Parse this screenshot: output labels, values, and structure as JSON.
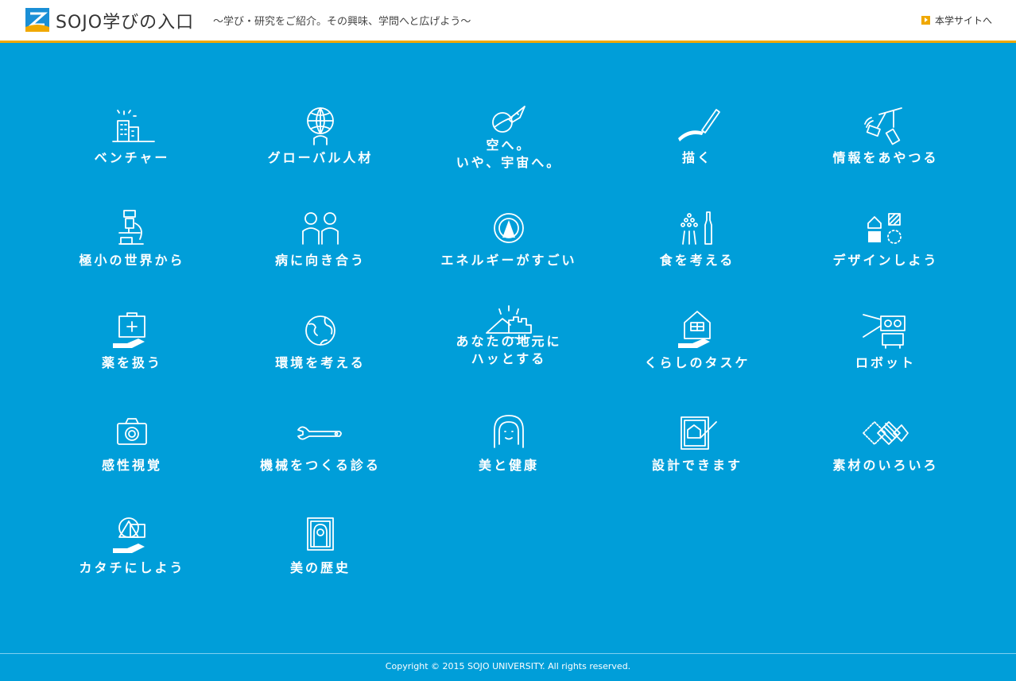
{
  "header": {
    "title": "SOJO学びの入口",
    "tagline": "〜学び・研究をご紹介。その興味、学問へと広げよう〜",
    "main_site_link": "本学サイトへ"
  },
  "tiles": [
    {
      "label": "ベンチャー",
      "icon": "buildings-icon"
    },
    {
      "label": "グローバル人材",
      "icon": "globe-person-icon"
    },
    {
      "label": "空へ。\nいや、宇宙へ。",
      "icon": "rocket-icon"
    },
    {
      "label": "描く",
      "icon": "pen-icon"
    },
    {
      "label": "情報をあやつる",
      "icon": "devices-icon"
    },
    {
      "label": "極小の世界から",
      "icon": "microscope-icon"
    },
    {
      "label": "病に向き合う",
      "icon": "people-icon"
    },
    {
      "label": "エネルギーがすごい",
      "icon": "energy-icon"
    },
    {
      "label": "食を考える",
      "icon": "food-icon"
    },
    {
      "label": "デザインしよう",
      "icon": "design-icon"
    },
    {
      "label": "薬を扱う",
      "icon": "medicine-box-icon"
    },
    {
      "label": "環境を考える",
      "icon": "earth-icon"
    },
    {
      "label": "あなたの地元に\nハッとする",
      "icon": "town-icon"
    },
    {
      "label": "くらしのタスケ",
      "icon": "house-icon"
    },
    {
      "label": "ロボット",
      "icon": "robot-icon"
    },
    {
      "label": "感性視覚",
      "icon": "camera-icon"
    },
    {
      "label": "機械をつくる診る",
      "icon": "wrench-icon"
    },
    {
      "label": "美と健康",
      "icon": "face-icon"
    },
    {
      "label": "設計できます",
      "icon": "blueprint-icon"
    },
    {
      "label": "素材のいろいろ",
      "icon": "material-icon"
    },
    {
      "label": "カタチにしよう",
      "icon": "shapes-icon"
    },
    {
      "label": "美の歴史",
      "icon": "portrait-icon"
    }
  ],
  "footer": {
    "copyright": "Copyright © 2015 SOJO UNIVERSITY. All rights reserved."
  },
  "colors": {
    "background": "#009ed9",
    "accent": "#f0a800",
    "header_bg": "#ffffff"
  }
}
